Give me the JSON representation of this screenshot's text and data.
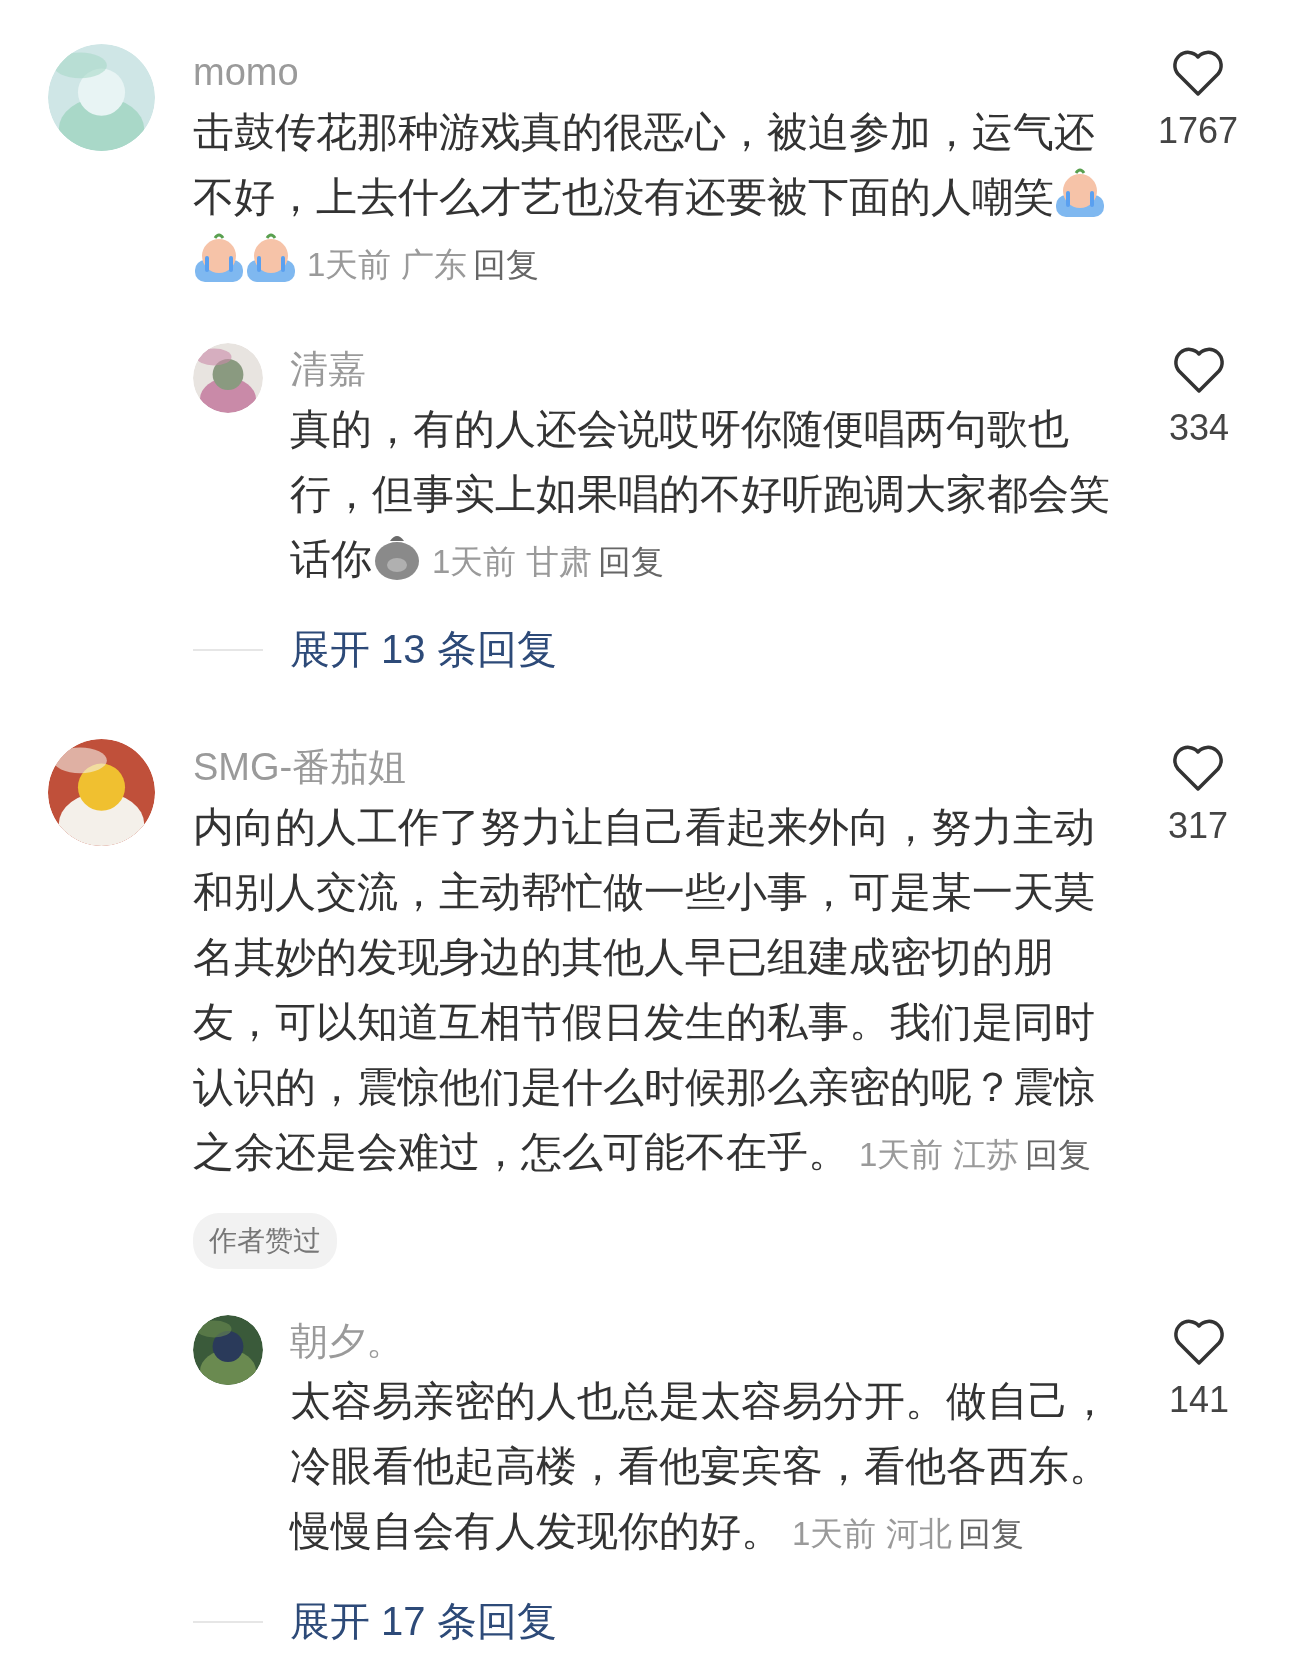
{
  "comments": [
    {
      "username": "momo",
      "text": "击鼓传花那种游戏真的很恶心，被迫参加，运气还不好，上去什么才艺也没有还要被下面的人嘲笑",
      "stickers": [
        {
          "kind": "crying"
        },
        {
          "kind": "crying"
        },
        {
          "kind": "crying"
        }
      ],
      "time": "1天前",
      "location": "广东",
      "reply": "回复",
      "likes": "1767",
      "replies": [
        {
          "username": "清嘉",
          "text": "真的，有的人还会说哎呀你随便唱两句歌也行，但事实上如果唱的不好听跑调大家都会笑话你",
          "stickers": [
            {
              "kind": "blob"
            }
          ],
          "time": "1天前",
          "location": "甘肃",
          "reply": "回复",
          "likes": "334"
        }
      ],
      "expand": "展开 13 条回复"
    },
    {
      "username": "SMG-番茄姐",
      "text": "内向的人工作了努力让自己看起来外向，努力主动和别人交流，主动帮忙做一些小事，可是某一天莫名其妙的发现身边的其他人早已组建成密切的朋友，可以知道互相节假日发生的私事。我们是同时认识的，震惊他们是什么时候那么亲密的呢？震惊之余还是会难过，怎么可能不在乎。",
      "time": "1天前",
      "location": "江苏",
      "reply": "回复",
      "likes": "317",
      "badge": "作者赞过",
      "replies": [
        {
          "username": "朝夕。",
          "text": "太容易亲密的人也总是太容易分开。做自己，冷眼看他起高楼，看他宴宾客，看他各西东。慢慢自会有人发现你的好。",
          "time": "1天前",
          "location": "河北",
          "reply": "回复",
          "likes": "141"
        }
      ],
      "expand": "展开 17 条回复"
    }
  ]
}
